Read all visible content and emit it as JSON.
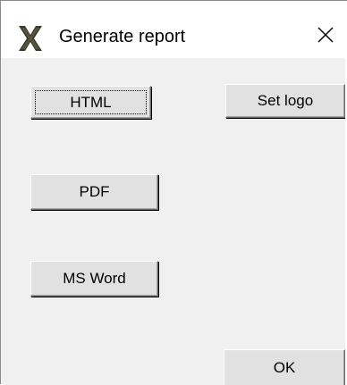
{
  "window": {
    "title": "Generate report",
    "icon": "x-logo-icon",
    "close_icon": "close-icon"
  },
  "buttons": {
    "html_label": "HTML",
    "set_logo_label": "Set logo",
    "pdf_label": "PDF",
    "ms_word_label": "MS Word",
    "ok_label": "OK"
  },
  "colors": {
    "app_icon": "#3a3a2a",
    "dialog_bg": "#f0f0f0",
    "button_face": "#e1e1e1"
  }
}
